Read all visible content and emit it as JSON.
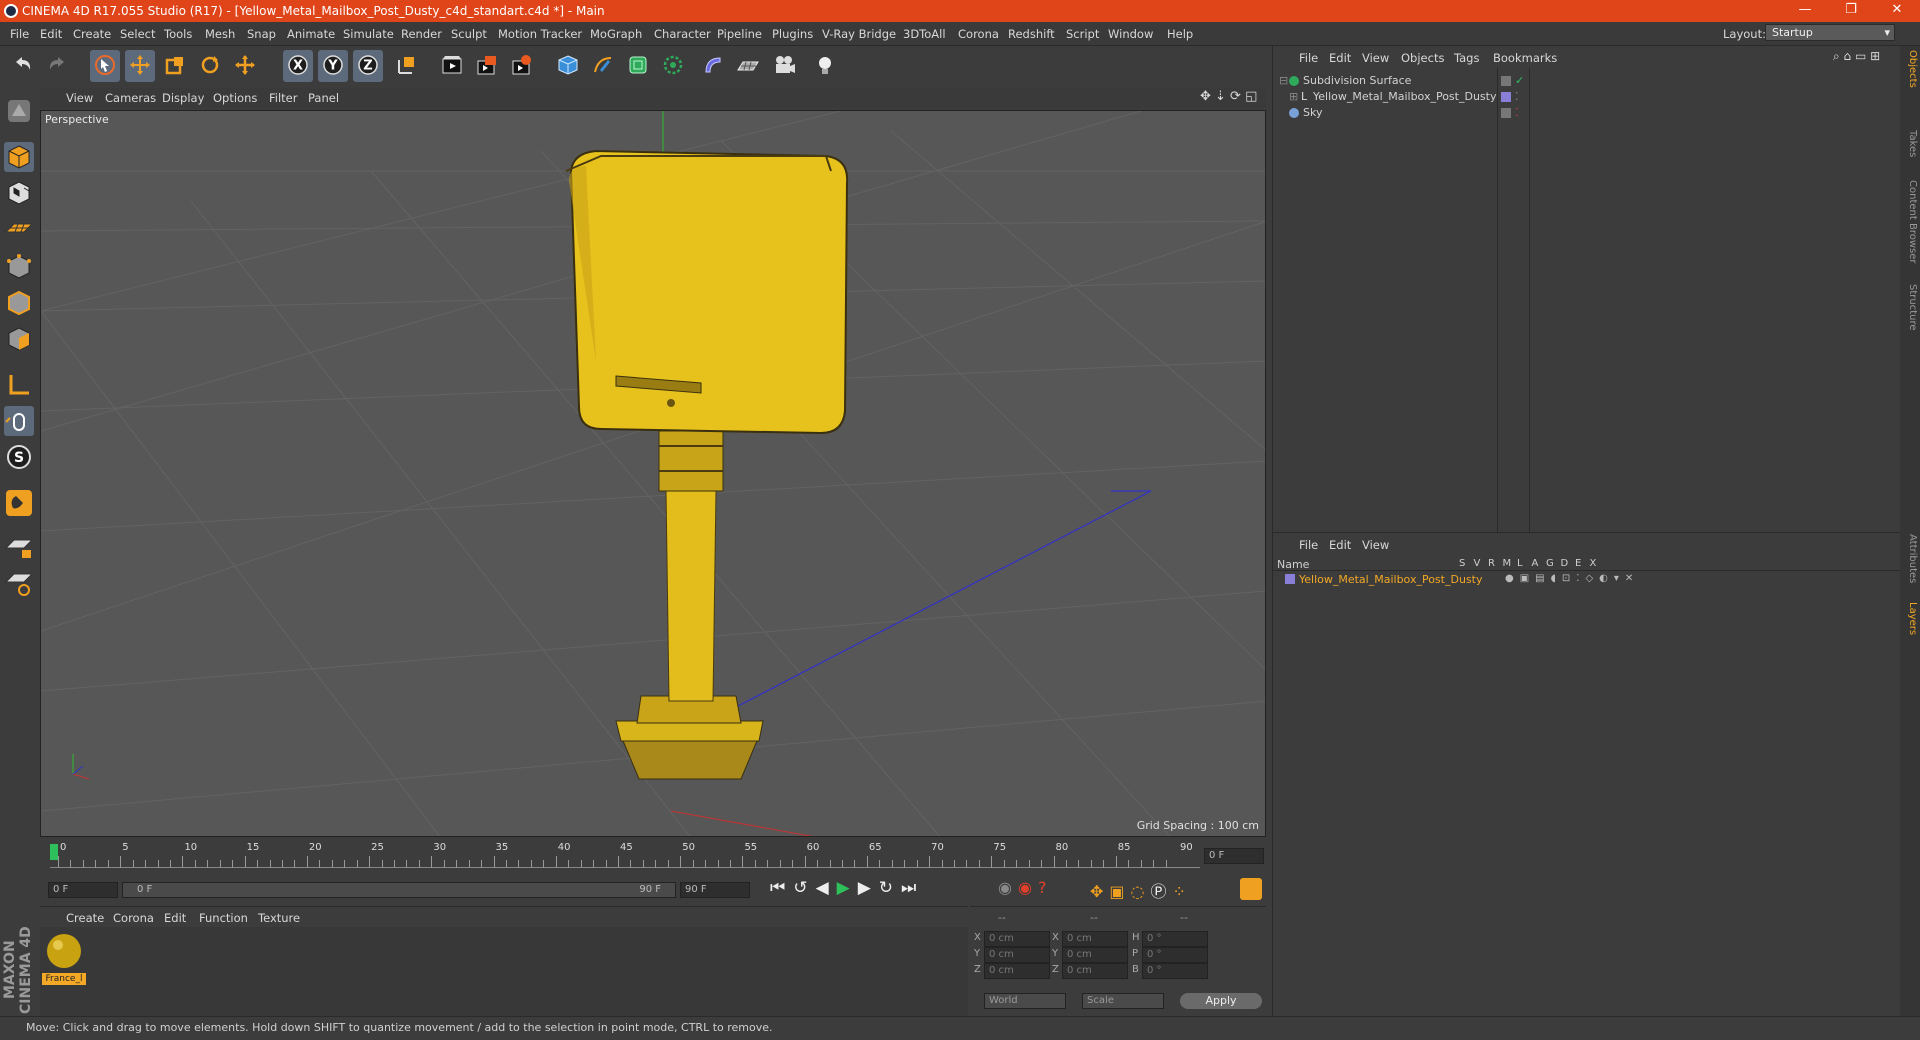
{
  "titlebar": {
    "title": "CINEMA 4D R17.055 Studio (R17) - [Yellow_Metal_Mailbox_Post_Dusty_c4d_standart.c4d *] - Main",
    "minimize": "—",
    "restore": "❐",
    "close": "✕"
  },
  "menubar": {
    "items": [
      "File",
      "Edit",
      "Create",
      "Select",
      "Tools",
      "Mesh",
      "Snap",
      "Animate",
      "Simulate",
      "Render",
      "Sculpt",
      "Motion Tracker",
      "MoGraph",
      "Character",
      "Pipeline",
      "Plugins",
      "V-Ray Bridge",
      "3DToAll",
      "Corona",
      "Redshift",
      "Script",
      "Window",
      "Help"
    ],
    "layout_label": "Layout:",
    "layout_value": "Startup"
  },
  "toolbar": {
    "icons": [
      "undo-icon",
      "redo-icon",
      "select-arrow-icon",
      "move-icon",
      "scale-icon",
      "rotate-icon",
      "move-world-icon",
      "x-axis-icon",
      "y-axis-icon",
      "z-axis-icon",
      "coordinate-system-icon",
      "render-view-icon",
      "render-picture-viewer-icon",
      "render-settings-icon",
      "cube-object-icon",
      "pen-spline-icon",
      "subdivision-surface-icon",
      "array-icon",
      "deformer-icon",
      "floor-icon",
      "camera-icon",
      "light-icon"
    ],
    "axis_labels": [
      "X",
      "Y",
      "Z"
    ]
  },
  "lefttools": {
    "icons": [
      "make-editable-icon",
      "model-mode-icon",
      "texture-mode-icon",
      "workplane-icon",
      "points-mode-icon",
      "edges-mode-icon",
      "polygons-mode-icon",
      "axis-mode-icon",
      "tweak-mode-icon",
      "snap-icon",
      "magnet-icon",
      "lock-workplane-icon",
      "grid-snap-icon"
    ],
    "snap_label": "S"
  },
  "viewport": {
    "menu": [
      "View",
      "Cameras",
      "Display",
      "Options",
      "Filter",
      "Panel"
    ],
    "label": "Perspective",
    "grid_spacing": "Grid Spacing : 100 cm"
  },
  "timeline": {
    "ticks": [
      "0",
      "5",
      "10",
      "15",
      "20",
      "25",
      "30",
      "35",
      "40",
      "45",
      "50",
      "55",
      "60",
      "65",
      "70",
      "75",
      "80",
      "85",
      "90"
    ],
    "current_frame": "0 F"
  },
  "transport": {
    "start": "0 F",
    "range_start": "0 F",
    "range_end": "90 F",
    "end": "90 F"
  },
  "materials": {
    "menu": [
      "Create",
      "Corona",
      "Edit",
      "Function",
      "Texture"
    ],
    "items": [
      {
        "name": "France_l"
      }
    ]
  },
  "coords": {
    "head": [
      "--",
      "--",
      "--"
    ],
    "rows": [
      {
        "a": "X",
        "av": "0 cm",
        "b": "X",
        "bv": "0 cm",
        "c": "H",
        "cv": "0 °"
      },
      {
        "a": "Y",
        "av": "0 cm",
        "b": "Y",
        "bv": "0 cm",
        "c": "P",
        "cv": "0 °"
      },
      {
        "a": "Z",
        "av": "0 cm",
        "b": "Z",
        "bv": "0 cm",
        "c": "B",
        "cv": "0 °"
      }
    ],
    "world": "World",
    "scale": "Scale",
    "apply": "Apply"
  },
  "objects": {
    "menu": [
      "File",
      "Edit",
      "View",
      "Objects",
      "Tags",
      "Bookmarks"
    ],
    "rows": [
      {
        "name": "Subdivision Surface"
      },
      {
        "name": "Yellow_Metal_Mailbox_Post_Dusty"
      },
      {
        "name": "Sky"
      }
    ]
  },
  "layers": {
    "menu": [
      "File",
      "Edit",
      "View"
    ],
    "columns_name": "Name",
    "columns": [
      "S",
      "V",
      "R",
      "M",
      "L",
      "A",
      "G",
      "D",
      "E",
      "X"
    ],
    "rows": [
      {
        "name": "Yellow_Metal_Mailbox_Post_Dusty"
      }
    ]
  },
  "rightstrip": {
    "tabs": [
      "Objects",
      "Takes",
      "Content Browser",
      "Structure",
      "Attributes",
      "Layers"
    ]
  },
  "status": {
    "text": "Move: Click and drag to move elements. Hold down SHIFT to quantize movement / add to the selection in point mode, CTRL to remove."
  },
  "branding": {
    "maxon": "MAXON CINEMA 4D"
  },
  "colors": {
    "accent": "#e0451a",
    "mailbox_yellow": "#e7c11c",
    "selected_text": "#f3a826",
    "layer_color": "#8a7fd6"
  }
}
